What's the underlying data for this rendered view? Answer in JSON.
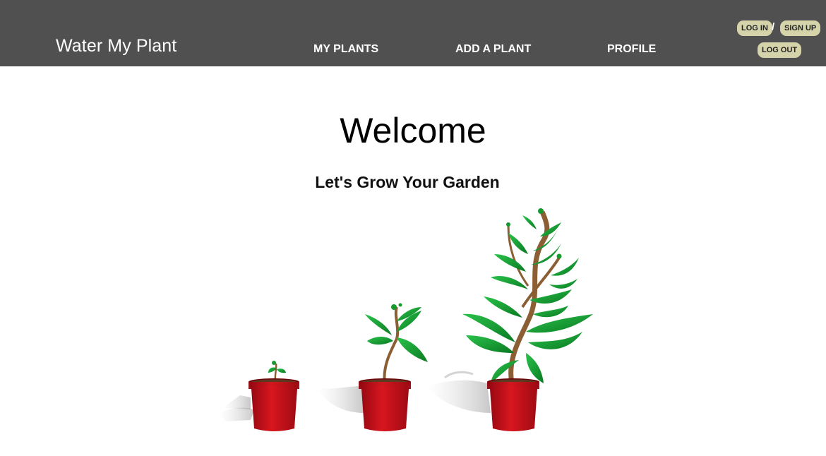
{
  "header": {
    "brand": "Water My Plant",
    "nav": [
      {
        "label": "MY PLANTS"
      },
      {
        "label": "ADD A PLANT"
      },
      {
        "label": "PROFILE"
      }
    ],
    "auth": {
      "login": "LOG IN",
      "separator": "/",
      "signup": "SIGN UP",
      "logout": "LOG OUT"
    }
  },
  "main": {
    "title": "Welcome",
    "subtitle": "Let's Grow Your Garden",
    "illustration": {
      "icon": "growing-plants-icon",
      "pots": [
        "seedling-pot-icon",
        "sprout-pot-icon",
        "grown-plant-pot-icon"
      ]
    }
  },
  "colors": {
    "header_bg": "#505050",
    "button_bg": "#d4d3a9",
    "pot_red": "#c4101a",
    "leaf_green": "#169a2e",
    "stem_brown": "#8b5e34"
  }
}
